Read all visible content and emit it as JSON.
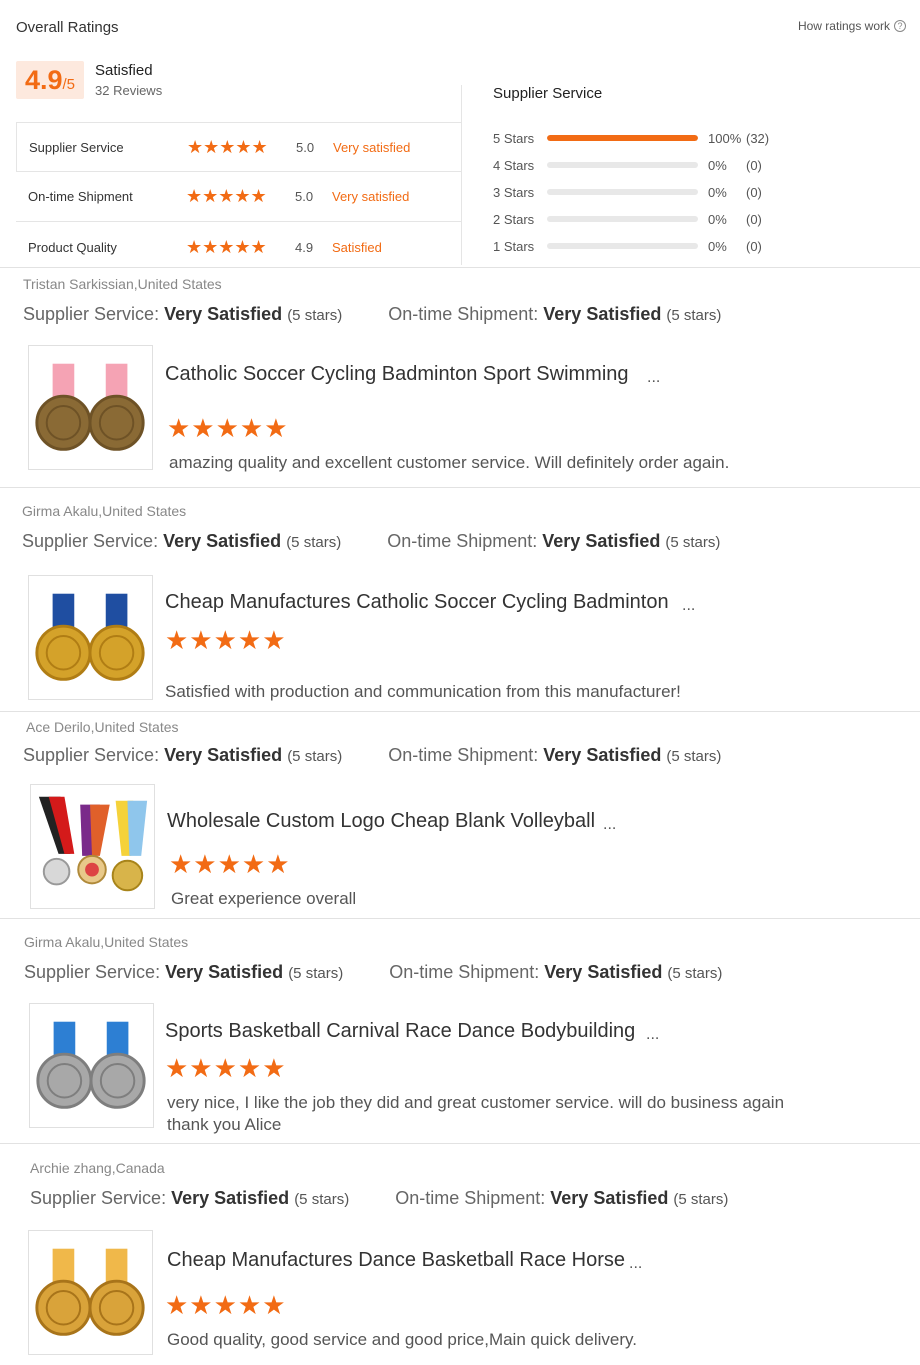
{
  "header": {
    "title": "Overall Ratings",
    "how_link": "How ratings work",
    "help_icon": "?"
  },
  "summary": {
    "score": "4.9",
    "score_suffix": "/5",
    "label": "Satisfied",
    "reviews": "32 Reviews"
  },
  "categories": [
    {
      "name": "Supplier Service",
      "stars": "★★★★★",
      "score": "5.0",
      "desc": "Very satisfied"
    },
    {
      "name": "On-time Shipment",
      "stars": "★★★★★",
      "score": "5.0",
      "desc": "Very satisfied"
    },
    {
      "name": "Product Quality",
      "stars": "★★★★★",
      "score": "4.9",
      "desc": "Satisfied"
    }
  ],
  "distribution": {
    "title": "Supplier Service",
    "rows": [
      {
        "label": "5 Stars",
        "fraction": 1.0,
        "pct": "100%",
        "count": "(32)"
      },
      {
        "label": "4 Stars",
        "fraction": 0,
        "pct": "0%",
        "count": "(0)"
      },
      {
        "label": "3 Stars",
        "fraction": 0,
        "pct": "0%",
        "count": "(0)"
      },
      {
        "label": "2 Stars",
        "fraction": 0,
        "pct": "0%",
        "count": "(0)"
      },
      {
        "label": "1 Stars",
        "fraction": 0,
        "pct": "0%",
        "count": "(0)"
      }
    ]
  },
  "labels": {
    "supplier_service": "Supplier Service:",
    "ontime_shipment": "On-time Shipment:",
    "very_satisfied": "Very Satisfied",
    "five_stars": "(5 stars)",
    "ellipsis": "...",
    "stars": "★★★★★"
  },
  "reviews": [
    {
      "author": "Tristan Sarkissian,United States",
      "product": "Catholic Soccer Cycling Badminton Sport Swimming",
      "comment": "amazing quality and excellent customer service. Will definitely order again.",
      "thumb_icon": "pink-ribbon-bronze-medals-icon"
    },
    {
      "author": "Girma Akalu,United States",
      "product": "Cheap Manufactures Catholic Soccer Cycling Badminton",
      "comment": "Satisfied with production and communication from this manufacturer!",
      "thumb_icon": "blue-ribbon-gold-medals-icon"
    },
    {
      "author": "Ace Derilo,United States",
      "product": "Wholesale Custom Logo Cheap Blank Volleyball",
      "comment": "Great experience overall",
      "thumb_icon": "striped-ribbon-medals-icon"
    },
    {
      "author": "Girma Akalu,United States",
      "product": "Sports Basketball Carnival Race Dance Bodybuilding",
      "comment": "very nice, I like the job they did and great customer service. will do business again thank you Alice",
      "thumb_icon": "blue-ribbon-silver-medals-icon"
    },
    {
      "author": "Archie zhang,Canada",
      "product": "Cheap Manufactures Dance Basketball Race Horse",
      "comment": "Good quality, good service and good price,Main quick delivery.",
      "thumb_icon": "piggy-run-gold-medals-icon"
    }
  ],
  "colors": {
    "accent": "#f26b14",
    "score_bg": "#fde9de",
    "bar_track": "#e8e8e8"
  }
}
